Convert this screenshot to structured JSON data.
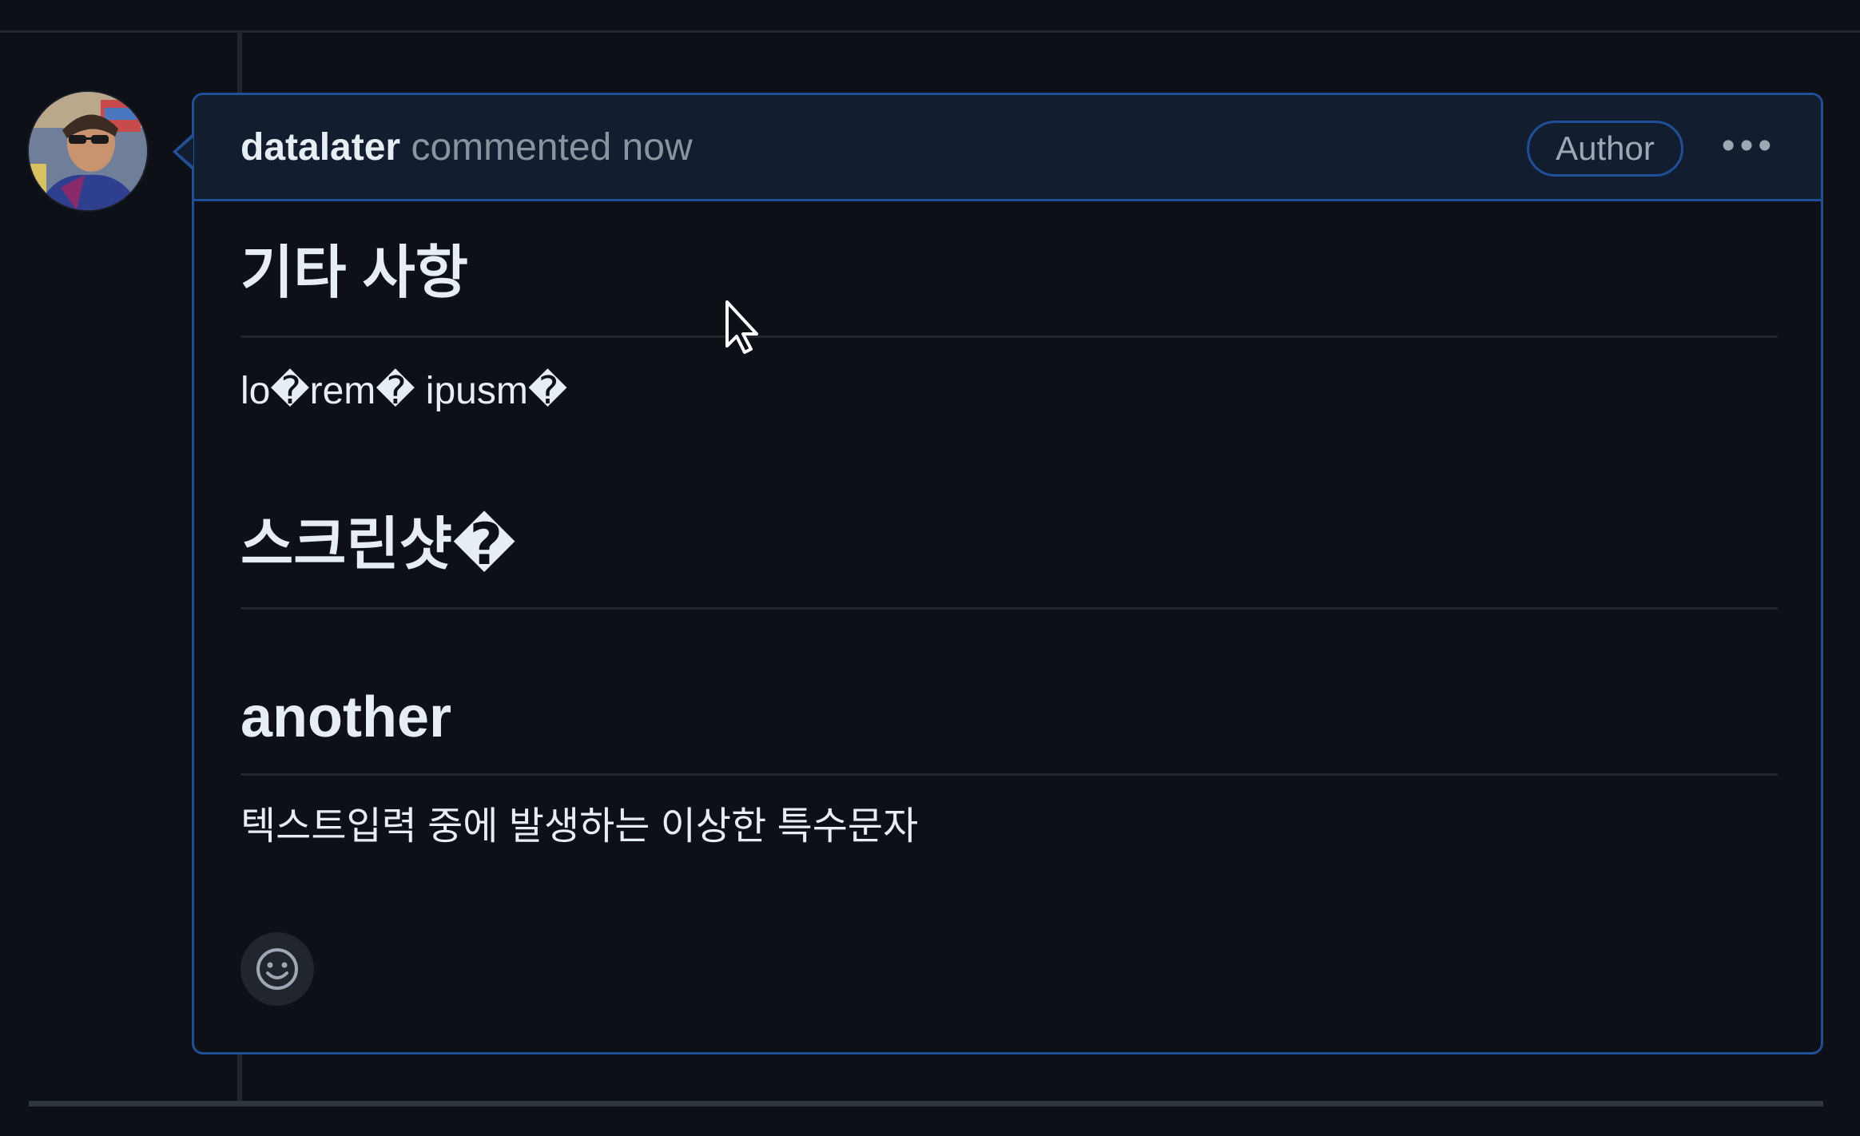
{
  "comment": {
    "author": "datalater",
    "meta": "commented now",
    "badge": "Author",
    "more_label": "•••"
  },
  "body": {
    "heading1": "기타 사항",
    "paragraph1": "lo�rem� ipusm�",
    "heading2": "스크린샷�",
    "heading3": "another",
    "paragraph2": "텍스트입력 중에 발생하는 이상한 특수문자"
  },
  "icons": {
    "avatar": "user-avatar",
    "reaction": "smiley-icon",
    "cursor": "mouse-pointer-icon",
    "more": "kebab-horizontal-icon"
  },
  "colors": {
    "background": "#0d1117",
    "header_bg": "#121d2f",
    "accent_border": "#1f4f96",
    "text": "#e6edf3",
    "muted": "#8b949e"
  }
}
